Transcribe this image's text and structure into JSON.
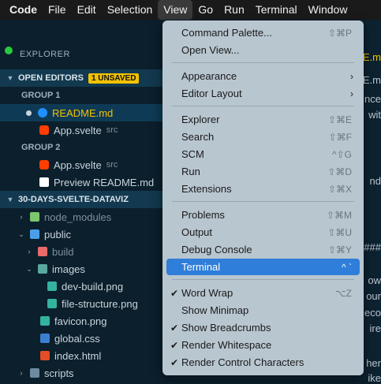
{
  "menubar": [
    "Code",
    "File",
    "Edit",
    "Selection",
    "View",
    "Go",
    "Run",
    "Terminal",
    "Window"
  ],
  "explorer": {
    "title": "EXPLORER",
    "open_editors": {
      "label": "OPEN EDITORS",
      "badge": "1 UNSAVED"
    },
    "group1": {
      "label": "GROUP 1",
      "items": [
        {
          "name": "README.md"
        },
        {
          "name": "App.svelte",
          "desc": "src"
        }
      ]
    },
    "group2": {
      "label": "GROUP 2",
      "items": [
        {
          "name": "App.svelte",
          "desc": "src"
        },
        {
          "name": "Preview README.md"
        }
      ]
    },
    "project": {
      "label": "30-DAYS-SVELTE-DATAVIZ"
    },
    "tree": [
      "node_modules",
      "public",
      "build",
      "images",
      "dev-build.png",
      "file-structure.png",
      "favicon.png",
      "global.css",
      "index.html",
      "scripts"
    ]
  },
  "editor_fragments": [
    "ME.m",
    "ME.m",
    "nce",
    "wit",
    "nd",
    "###",
    "ow",
    "our",
    "eco",
    "ire",
    "her",
    "ike"
  ],
  "menu": {
    "items": [
      {
        "label": "Command Palette...",
        "shortcut": "⇧⌘P"
      },
      {
        "label": "Open View...",
        "shortcut": ""
      },
      {
        "label": "Appearance",
        "shortcut": ""
      },
      {
        "label": "Editor Layout",
        "shortcut": ""
      },
      {
        "label": "Explorer",
        "shortcut": "⇧⌘E"
      },
      {
        "label": "Search",
        "shortcut": "⇧⌘F"
      },
      {
        "label": "SCM",
        "shortcut": "^⇧G"
      },
      {
        "label": "Run",
        "shortcut": "⇧⌘D"
      },
      {
        "label": "Extensions",
        "shortcut": "⇧⌘X"
      },
      {
        "label": "Problems",
        "shortcut": "⇧⌘M"
      },
      {
        "label": "Output",
        "shortcut": "⇧⌘U"
      },
      {
        "label": "Debug Console",
        "shortcut": "⇧⌘Y"
      },
      {
        "label": "Terminal",
        "shortcut": "^ `"
      },
      {
        "label": "Word Wrap",
        "shortcut": "⌥Z"
      },
      {
        "label": "Show Minimap",
        "shortcut": ""
      },
      {
        "label": "Show Breadcrumbs",
        "shortcut": ""
      },
      {
        "label": "Render Whitespace",
        "shortcut": ""
      },
      {
        "label": "Render Control Characters",
        "shortcut": ""
      }
    ],
    "checked": [
      "Word Wrap",
      "Show Breadcrumbs",
      "Render Whitespace",
      "Render Control Characters"
    ],
    "highlighted": "Terminal"
  }
}
